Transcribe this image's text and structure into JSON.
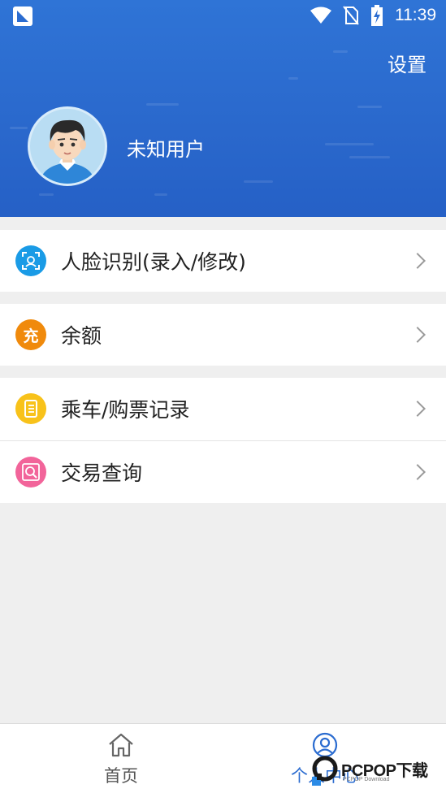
{
  "status_bar": {
    "time": "11:39",
    "icons": [
      "app-notification-icon",
      "wifi-icon",
      "no-sim-icon",
      "battery-charging-icon"
    ]
  },
  "header": {
    "settings_label": "设置",
    "username": "未知用户",
    "background_color": "#2b6cd0"
  },
  "menu": {
    "groups": [
      {
        "items": [
          {
            "label": "人脸识别(录入/修改)",
            "icon": "face-scan-icon",
            "color": "#1a9be6"
          }
        ]
      },
      {
        "items": [
          {
            "label": "余额",
            "icon": "recharge-icon",
            "icon_text": "充",
            "color": "#f08a0c"
          }
        ]
      },
      {
        "items": [
          {
            "label": "乘车/购票记录",
            "icon": "record-list-icon",
            "color": "#f8c21a"
          },
          {
            "label": "交易查询",
            "icon": "transaction-search-icon",
            "color": "#f2649a"
          }
        ]
      }
    ]
  },
  "bottom_nav": {
    "items": [
      {
        "label": "首页",
        "icon": "home-icon",
        "active": false,
        "color": "#555555"
      },
      {
        "label": "个人中心",
        "icon": "user-icon",
        "active": true,
        "color": "#2b6cd0"
      }
    ]
  },
  "watermark": {
    "text": "PCPOP下载",
    "sub": "PCPOP Download"
  }
}
